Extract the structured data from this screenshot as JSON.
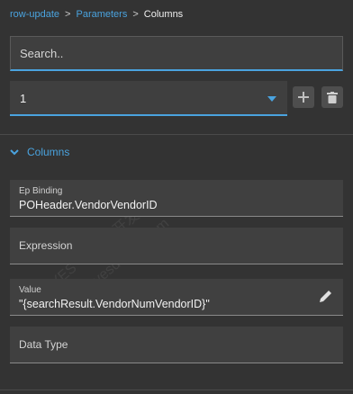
{
  "breadcrumb": {
    "items": [
      "row-update",
      "Parameters"
    ],
    "separator": ">",
    "current": "Columns"
  },
  "search": {
    "placeholder": "Search.."
  },
  "select": {
    "value": "1"
  },
  "section": {
    "title": "Columns"
  },
  "fields": {
    "ep_binding": {
      "label": "Ep Binding",
      "value": "POHeader.VendorVendorID"
    },
    "expression": {
      "label": "Expression"
    },
    "value": {
      "label": "Value",
      "value": "\"{searchResult.VendorNumVendorID}\""
    },
    "data_type": {
      "label": "Data Type"
    }
  },
  "watermark": {
    "line1": "YES · dotnet开发框架",
    "line2": "www.yesdotnet.com"
  },
  "colors": {
    "accent": "#4aa3df",
    "background": "#333333",
    "field_bg": "#404040"
  }
}
